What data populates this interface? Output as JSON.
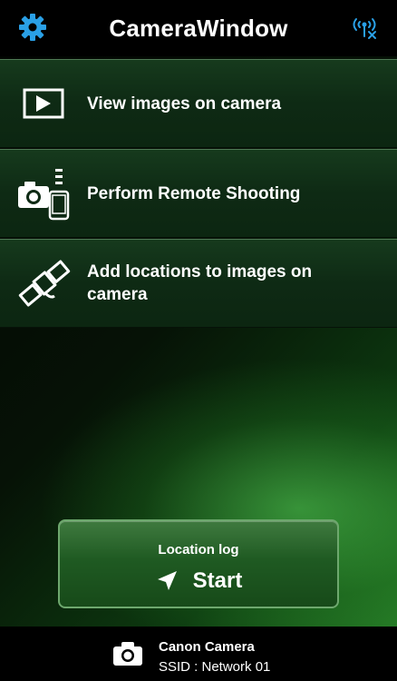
{
  "header": {
    "title": "CameraWindow",
    "settings_icon": "gear-icon",
    "wifi_icon": "wifi-disconnect-icon",
    "accent_color": "#2aa0e6"
  },
  "menu": [
    {
      "label": "View images on camera",
      "icon": "play-icon"
    },
    {
      "label": "Perform Remote Shooting",
      "icon": "remote-camera-phone-icon"
    },
    {
      "label": "Add locations to images on camera",
      "icon": "satellite-icon"
    }
  ],
  "location_log": {
    "caption": "Location log",
    "start_label": "Start",
    "icon": "location-arrow-icon"
  },
  "footer": {
    "camera_name": "Canon Camera",
    "ssid": "SSID : Network 01",
    "icon": "camera-icon"
  }
}
